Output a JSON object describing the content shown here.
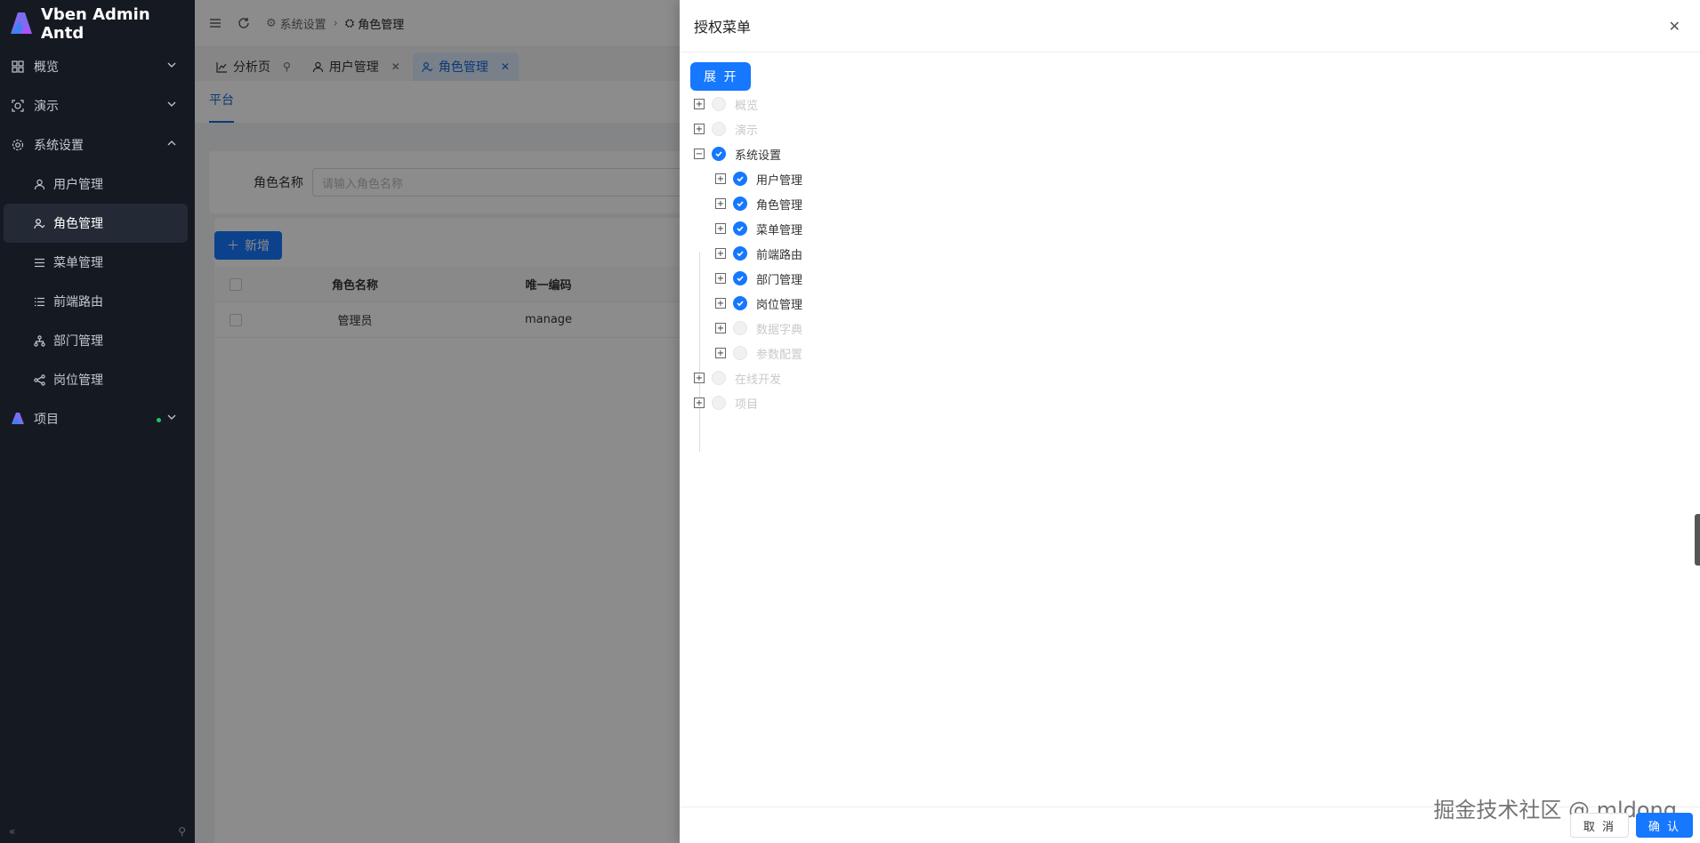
{
  "app": {
    "title": "Vben Admin Antd"
  },
  "sidebar": {
    "items": [
      {
        "label": "概览",
        "icon": "dashboard-icon"
      },
      {
        "label": "演示",
        "icon": "demo-icon"
      },
      {
        "label": "系统设置",
        "icon": "gear-icon"
      },
      {
        "label": "项目",
        "icon": "project-icon"
      }
    ],
    "sub_items": [
      {
        "label": "用户管理",
        "icon": "user-icon"
      },
      {
        "label": "角色管理",
        "icon": "role-icon"
      },
      {
        "label": "菜单管理",
        "icon": "menu-icon"
      },
      {
        "label": "前端路由",
        "icon": "list-icon"
      },
      {
        "label": "部门管理",
        "icon": "org-icon"
      },
      {
        "label": "岗位管理",
        "icon": "share-icon"
      }
    ]
  },
  "header": {
    "breadcrumb": [
      "系统设置",
      "角色管理"
    ]
  },
  "tabs": [
    {
      "label": "分析页"
    },
    {
      "label": "用户管理"
    },
    {
      "label": "角色管理"
    }
  ],
  "subtab": "平台",
  "search": {
    "label": "角色名称",
    "placeholder": "请输入角色名称"
  },
  "toolbar": {
    "add_label": "新增"
  },
  "table": {
    "columns": [
      "角色名称",
      "唯一编码"
    ],
    "rows": [
      {
        "name": "管理员",
        "code": "manage"
      }
    ]
  },
  "drawer": {
    "title": "授权菜单",
    "expand_label": "展 开",
    "cancel_label": "取 消",
    "ok_label": "确 认",
    "tree": [
      {
        "label": "概览",
        "checked": false
      },
      {
        "label": "演示",
        "checked": false
      },
      {
        "label": "系统设置",
        "checked": true,
        "expanded": true
      },
      {
        "label": "用户管理",
        "checked": true
      },
      {
        "label": "角色管理",
        "checked": true
      },
      {
        "label": "菜单管理",
        "checked": true
      },
      {
        "label": "前端路由",
        "checked": true
      },
      {
        "label": "部门管理",
        "checked": true
      },
      {
        "label": "岗位管理",
        "checked": true
      },
      {
        "label": "数据字典",
        "checked": false
      },
      {
        "label": "参数配置",
        "checked": false
      },
      {
        "label": "在线开发",
        "checked": false
      },
      {
        "label": "项目",
        "checked": false
      }
    ]
  },
  "watermark": "掘金技术社区 @ mldong",
  "colors": {
    "primary": "#1677ff",
    "sidebar_bg": "#151a22"
  }
}
